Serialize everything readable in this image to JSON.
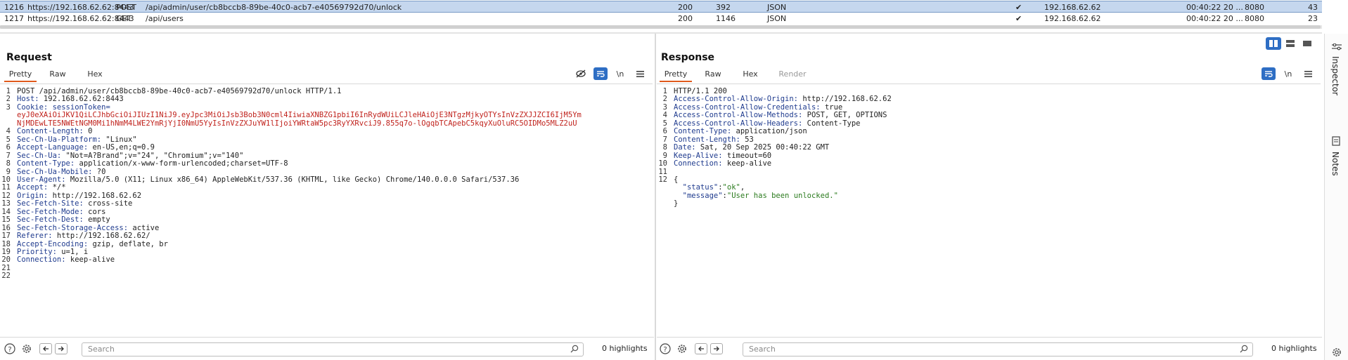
{
  "history": {
    "rows": [
      {
        "num": "1216",
        "host": "https://192.168.62.62:8443",
        "method": "POST",
        "url": "/api/admin/user/cb8bccb8-89be-40c0-acb7-e40569792d70/unlock",
        "status": "200",
        "length": "392",
        "mime": "JSON",
        "check": "✔",
        "ip": "192.168.62.62",
        "time": "00:40:22 20 ...",
        "port": "8080",
        "id": "43",
        "selected": true
      },
      {
        "num": "1217",
        "host": "https://192.168.62.62:8443",
        "method": "GET",
        "url": "/api/users",
        "status": "200",
        "length": "1146",
        "mime": "JSON",
        "check": "✔",
        "ip": "192.168.62.62",
        "time": "00:40:22 20 ...",
        "port": "8080",
        "id": "23",
        "selected": false
      }
    ]
  },
  "request": {
    "title": "Request",
    "tabs": [
      "Pretty",
      "Raw",
      "Hex"
    ],
    "active_tab": "Pretty",
    "newline_label": "\\n",
    "lines": [
      {
        "n": "1",
        "parts": [
          {
            "t": "POST /api/admin/user/cb8bccb8-89be-40c0-acb7-e40569792d70/unlock HTTP/1.1",
            "c": "plain"
          }
        ]
      },
      {
        "n": "2",
        "parts": [
          {
            "t": "Host:",
            "c": "hname"
          },
          {
            "t": " 192.168.62.62:8443",
            "c": "plain"
          }
        ]
      },
      {
        "n": "3",
        "parts": [
          {
            "t": "Cookie:",
            "c": "hname"
          },
          {
            "t": " sessionToken=",
            "c": "hname"
          }
        ]
      },
      {
        "n": "",
        "parts": [
          {
            "t": "eyJ0eXAiOiJKV1QiLCJhbGciOiJIUzI1NiJ9.eyJpc3MiOiJsb3Bob3N0cml4IiwiaXNBZG1pbiI6InRydWUiLCJleHAiOjE3NTgzMjkyOTYsInVzZXJJZCI6IjM5Ym",
            "c": "cookieval"
          }
        ]
      },
      {
        "n": "",
        "parts": [
          {
            "t": "NjMDEwLTE5NWEtNGM0Mi1hNmM4LWE2YmRjYjI0NmU5YyIsInVzZXJuYW1lIjoiYWRtaW5pc3RyYXRvciJ9.855q7o-lOgqbTCApebC5kqyXuOluRC5OIDMo5MLZ2uU",
            "c": "cookieval"
          }
        ]
      },
      {
        "n": "4",
        "parts": [
          {
            "t": "Content-Length:",
            "c": "hname"
          },
          {
            "t": " 0",
            "c": "plain"
          }
        ]
      },
      {
        "n": "5",
        "parts": [
          {
            "t": "Sec-Ch-Ua-Platform:",
            "c": "hname"
          },
          {
            "t": " \"Linux\"",
            "c": "plain"
          }
        ]
      },
      {
        "n": "6",
        "parts": [
          {
            "t": "Accept-Language:",
            "c": "hname"
          },
          {
            "t": " en-US,en;q=0.9",
            "c": "plain"
          }
        ]
      },
      {
        "n": "7",
        "parts": [
          {
            "t": "Sec-Ch-Ua:",
            "c": "hname"
          },
          {
            "t": " \"Not=A?Brand\";v=\"24\", \"Chromium\";v=\"140\"",
            "c": "plain"
          }
        ]
      },
      {
        "n": "8",
        "parts": [
          {
            "t": "Content-Type:",
            "c": "hname"
          },
          {
            "t": " application/x-www-form-urlencoded;charset=UTF-8",
            "c": "plain"
          }
        ]
      },
      {
        "n": "9",
        "parts": [
          {
            "t": "Sec-Ch-Ua-Mobile:",
            "c": "hname"
          },
          {
            "t": " ?0",
            "c": "plain"
          }
        ]
      },
      {
        "n": "10",
        "parts": [
          {
            "t": "User-Agent:",
            "c": "hname"
          },
          {
            "t": " Mozilla/5.0 (X11; Linux x86_64) AppleWebKit/537.36 (KHTML, like Gecko) Chrome/140.0.0.0 Safari/537.36",
            "c": "plain"
          }
        ]
      },
      {
        "n": "11",
        "parts": [
          {
            "t": "Accept:",
            "c": "hname"
          },
          {
            "t": " */*",
            "c": "plain"
          }
        ]
      },
      {
        "n": "12",
        "parts": [
          {
            "t": "Origin:",
            "c": "hname"
          },
          {
            "t": " http://192.168.62.62",
            "c": "plain"
          }
        ]
      },
      {
        "n": "13",
        "parts": [
          {
            "t": "Sec-Fetch-Site:",
            "c": "hname"
          },
          {
            "t": " cross-site",
            "c": "plain"
          }
        ]
      },
      {
        "n": "14",
        "parts": [
          {
            "t": "Sec-Fetch-Mode:",
            "c": "hname"
          },
          {
            "t": " cors",
            "c": "plain"
          }
        ]
      },
      {
        "n": "15",
        "parts": [
          {
            "t": "Sec-Fetch-Dest:",
            "c": "hname"
          },
          {
            "t": " empty",
            "c": "plain"
          }
        ]
      },
      {
        "n": "16",
        "parts": [
          {
            "t": "Sec-Fetch-Storage-Access:",
            "c": "hname"
          },
          {
            "t": " active",
            "c": "plain"
          }
        ]
      },
      {
        "n": "17",
        "parts": [
          {
            "t": "Referer:",
            "c": "hname"
          },
          {
            "t": " http://192.168.62.62/",
            "c": "plain"
          }
        ]
      },
      {
        "n": "18",
        "parts": [
          {
            "t": "Accept-Encoding:",
            "c": "hname"
          },
          {
            "t": " gzip, deflate, br",
            "c": "plain"
          }
        ]
      },
      {
        "n": "19",
        "parts": [
          {
            "t": "Priority:",
            "c": "hname"
          },
          {
            "t": " u=1, i",
            "c": "plain"
          }
        ]
      },
      {
        "n": "20",
        "parts": [
          {
            "t": "Connection:",
            "c": "hname"
          },
          {
            "t": " keep-alive",
            "c": "plain"
          }
        ]
      },
      {
        "n": "21",
        "parts": []
      },
      {
        "n": "22",
        "parts": []
      }
    ],
    "search_placeholder": "Search",
    "highlights": "0 highlights"
  },
  "response": {
    "title": "Response",
    "tabs": [
      "Pretty",
      "Raw",
      "Hex",
      "Render"
    ],
    "active_tab": "Pretty",
    "newline_label": "\\n",
    "lines": [
      {
        "n": "1",
        "parts": [
          {
            "t": "HTTP/1.1 200",
            "c": "plain"
          }
        ]
      },
      {
        "n": "2",
        "parts": [
          {
            "t": "Access-Control-Allow-Origin:",
            "c": "hname"
          },
          {
            "t": " http://192.168.62.62",
            "c": "plain"
          }
        ]
      },
      {
        "n": "3",
        "parts": [
          {
            "t": "Access-Control-Allow-Credentials:",
            "c": "hname"
          },
          {
            "t": " true",
            "c": "plain"
          }
        ]
      },
      {
        "n": "4",
        "parts": [
          {
            "t": "Access-Control-Allow-Methods:",
            "c": "hname"
          },
          {
            "t": " POST, GET, OPTIONS",
            "c": "plain"
          }
        ]
      },
      {
        "n": "5",
        "parts": [
          {
            "t": "Access-Control-Allow-Headers:",
            "c": "hname"
          },
          {
            "t": " Content-Type",
            "c": "plain"
          }
        ]
      },
      {
        "n": "6",
        "parts": [
          {
            "t": "Content-Type:",
            "c": "hname"
          },
          {
            "t": " application/json",
            "c": "plain"
          }
        ]
      },
      {
        "n": "7",
        "parts": [
          {
            "t": "Content-Length:",
            "c": "hname"
          },
          {
            "t": " 53",
            "c": "plain"
          }
        ]
      },
      {
        "n": "8",
        "parts": [
          {
            "t": "Date:",
            "c": "hname"
          },
          {
            "t": " Sat, 20 Sep 2025 00:40:22 GMT",
            "c": "plain"
          }
        ]
      },
      {
        "n": "9",
        "parts": [
          {
            "t": "Keep-Alive:",
            "c": "hname"
          },
          {
            "t": " timeout=60",
            "c": "plain"
          }
        ]
      },
      {
        "n": "10",
        "parts": [
          {
            "t": "Connection:",
            "c": "hname"
          },
          {
            "t": " keep-alive",
            "c": "plain"
          }
        ]
      },
      {
        "n": "11",
        "parts": []
      },
      {
        "n": "12",
        "parts": [
          {
            "t": "{",
            "c": "plain"
          }
        ]
      },
      {
        "n": "",
        "parts": [
          {
            "t": "  \"status\"",
            "c": "jkey"
          },
          {
            "t": ":",
            "c": "plain"
          },
          {
            "t": "\"ok\"",
            "c": "jstr"
          },
          {
            "t": ",",
            "c": "plain"
          }
        ]
      },
      {
        "n": "",
        "parts": [
          {
            "t": "  \"message\"",
            "c": "jkey"
          },
          {
            "t": ":",
            "c": "plain"
          },
          {
            "t": "\"User has been unlocked.\"",
            "c": "jstr"
          }
        ]
      },
      {
        "n": "",
        "parts": [
          {
            "t": "}",
            "c": "plain"
          }
        ]
      }
    ],
    "search_placeholder": "Search",
    "highlights": "0 highlights"
  },
  "sidebar": {
    "inspector": "Inspector",
    "notes": "Notes"
  },
  "colors": {
    "accent": "#2e6ec4",
    "tab_active": "#e05a1c",
    "header_name": "#1f3b8e",
    "cookie": "#c0221c",
    "json_string": "#2b7b1e",
    "selected_row": "#c5d7ee"
  }
}
